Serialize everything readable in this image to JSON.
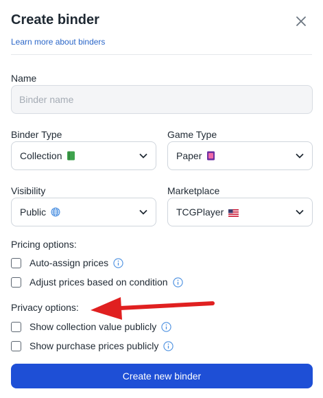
{
  "header": {
    "title": "Create binder",
    "learn_link": "Learn more about binders"
  },
  "name_field": {
    "label": "Name",
    "placeholder": "Binder name",
    "value": ""
  },
  "binder_type": {
    "label": "Binder Type",
    "value": "Collection",
    "icon": "green-book-icon"
  },
  "game_type": {
    "label": "Game Type",
    "value": "Paper",
    "icon": "card-icon"
  },
  "visibility": {
    "label": "Visibility",
    "value": "Public",
    "icon": "globe-icon"
  },
  "marketplace": {
    "label": "Marketplace",
    "value": "TCGPlayer",
    "icon": "us-flag-icon"
  },
  "pricing": {
    "label": "Pricing options:",
    "options": [
      {
        "label": "Auto-assign prices",
        "checked": false
      },
      {
        "label": "Adjust prices based on condition",
        "checked": false
      }
    ]
  },
  "privacy": {
    "label": "Privacy options:",
    "options": [
      {
        "label": "Show collection value publicly",
        "checked": false
      },
      {
        "label": "Show purchase prices publicly",
        "checked": false
      }
    ]
  },
  "submit": {
    "label": "Create new binder"
  },
  "colors": {
    "accent": "#1e4fd6",
    "link": "#2a66c8",
    "annotation_arrow": "#e02020"
  }
}
